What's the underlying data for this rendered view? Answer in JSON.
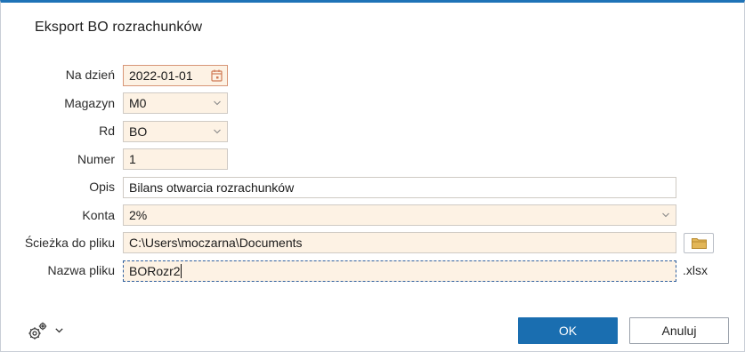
{
  "dialog": {
    "title": "Eksport BO rozrachunków"
  },
  "form": {
    "date": {
      "label": "Na dzień",
      "value": "2022-01-01",
      "icon": "calendar-icon"
    },
    "warehouse": {
      "label": "Magazyn",
      "value": "M0"
    },
    "doc_type": {
      "label": "Rd",
      "value": "BO"
    },
    "number": {
      "label": "Numer",
      "value": "1"
    },
    "description": {
      "label": "Opis",
      "value": "Bilans otwarcia rozrachunków"
    },
    "accounts": {
      "label": "Konta",
      "value": "2%"
    },
    "path": {
      "label": "Ścieżka do pliku",
      "value": "C:\\Users\\moczarna\\Documents",
      "icon": "folder-icon"
    },
    "filename": {
      "label": "Nazwa pliku",
      "value": "BORozr2",
      "extension": ".xlsx"
    }
  },
  "footer": {
    "settings_icon": "gear-icon",
    "ok_label": "OK",
    "cancel_label": "Anuluj"
  },
  "colors": {
    "accent": "#1a6eb0",
    "field_background": "#fdf2e4",
    "date_border": "#d79677"
  }
}
